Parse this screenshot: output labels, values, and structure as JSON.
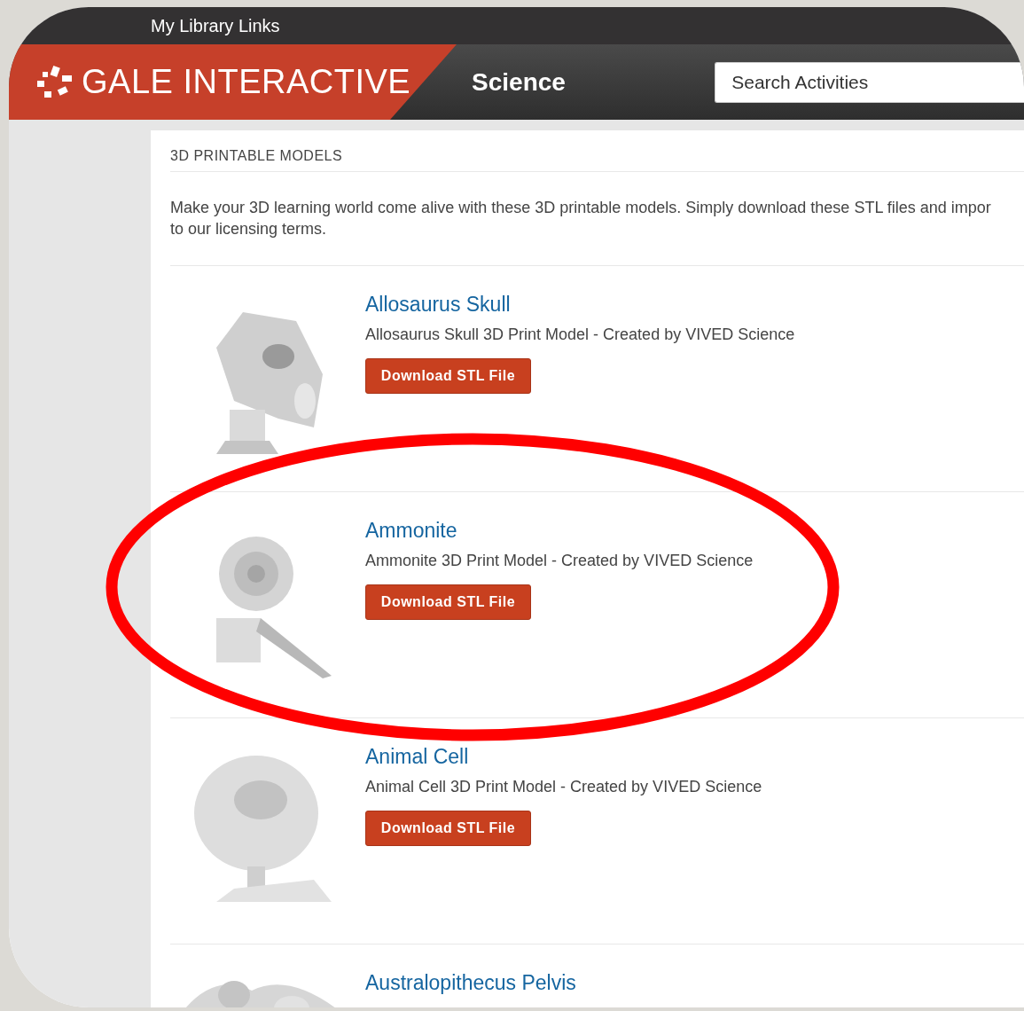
{
  "top_bar": {
    "link": "My Library Links"
  },
  "header": {
    "logo": "**GALE** INTERACTIVE",
    "section": "Science",
    "search": {
      "placeholder": "Search Activities"
    }
  },
  "content": {
    "heading": "3D PRINTABLE MODELS",
    "intro_lines": [
      "Make your 3D learning world come alive with these 3D printable models. Simply download these STL files and impor",
      "to our licensing terms."
    ],
    "models": [
      {
        "kind": "skull",
        "title": "Allosaurus Skull",
        "description": "Allosaurus Skull 3D Print Model - Created by VIVED Science",
        "button": "Download STL File"
      },
      {
        "kind": "shell",
        "title": "Ammonite",
        "description": "Ammonite 3D Print Model - Created by VIVED Science",
        "button": "Download STL File"
      },
      {
        "kind": "cell",
        "title": "Animal Cell",
        "description": "Animal Cell 3D Print Model - Created by VIVED Science",
        "button": "Download STL File"
      },
      {
        "kind": "bone",
        "title": "Australopithecus Pelvis"
      }
    ]
  }
}
